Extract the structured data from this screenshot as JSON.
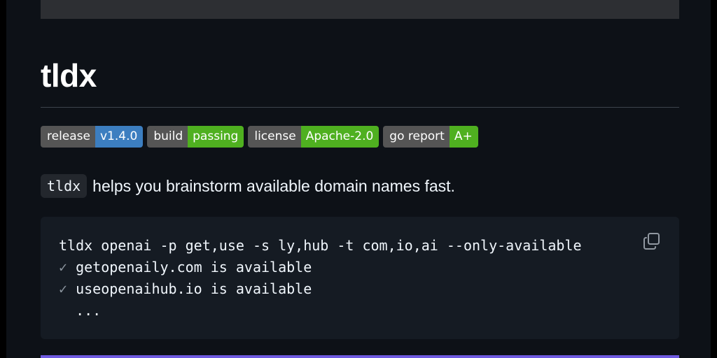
{
  "readme": {
    "title": "tldx",
    "badges": [
      {
        "label": "release",
        "value": "v1.4.0",
        "color": "#3c7ec0"
      },
      {
        "label": "build",
        "value": "passing",
        "color": "#4fb020"
      },
      {
        "label": "license",
        "value": "Apache-2.0",
        "color": "#4fb020"
      },
      {
        "label": "go report",
        "value": "A+",
        "color": "#4fb020"
      }
    ],
    "description": {
      "code": "tldx",
      "text": "helps you brainstorm available domain names fast."
    },
    "code_block": {
      "command": "tldx openai -p get,use -s ly,hub -t com,io,ai --only-available",
      "check_symbol": "✓",
      "results": [
        "getopenaily.com is available",
        "useopenaihub.io is available"
      ],
      "ellipsis": "  ..."
    },
    "copy_icon": "copy-icon"
  }
}
